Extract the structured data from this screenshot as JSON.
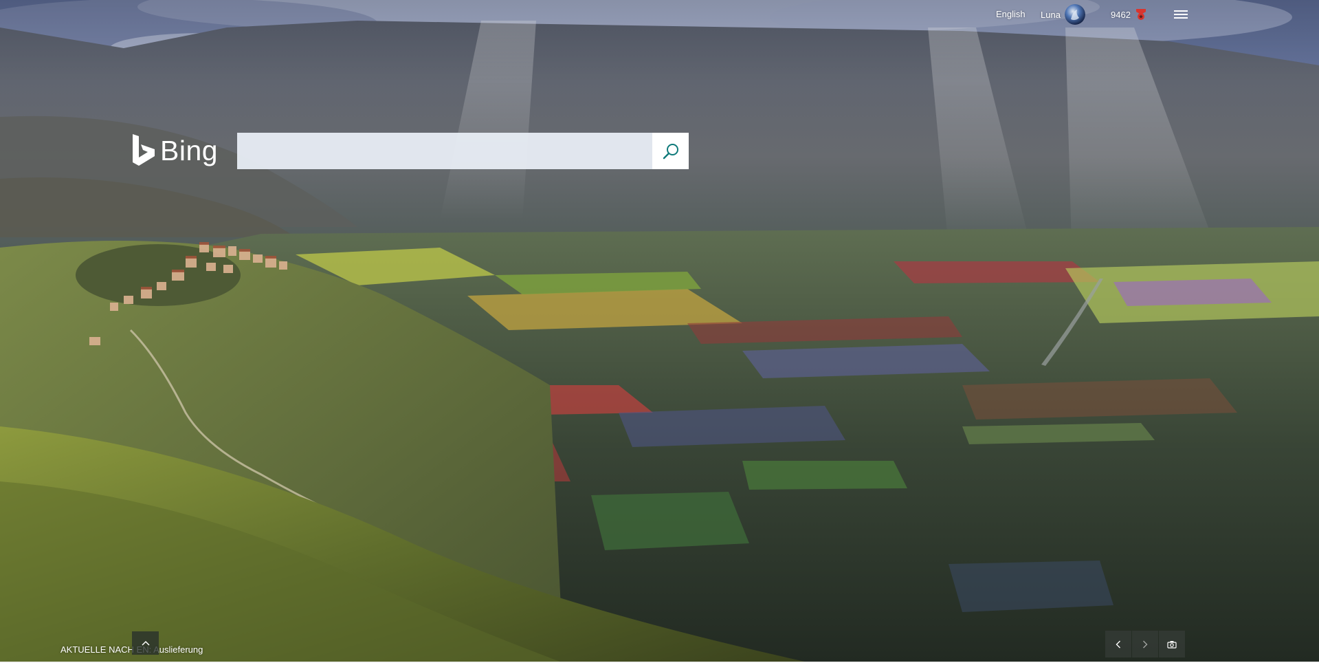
{
  "header": {
    "language_link": "English",
    "user_name": "Luna",
    "rewards_points": "9462"
  },
  "brand": {
    "logo_text": "Bing"
  },
  "search": {
    "value": "",
    "placeholder": ""
  },
  "footer": {
    "news_ticker": "AKTUELLE NACH EN: Auslieferung"
  },
  "icons": {
    "logo": "bing-b-icon",
    "search": "search-icon",
    "rewards": "rewards-medal-icon",
    "menu": "hamburger-menu-icon",
    "scroll_up": "chevron-up-icon",
    "previous": "chevron-left-icon",
    "next": "chevron-right-icon",
    "camera": "camera-icon"
  },
  "colors": {
    "search_icon": "#0f7a7a",
    "rewards_medal": "#d9352f",
    "search_field_bg": "#ebf0f7"
  }
}
